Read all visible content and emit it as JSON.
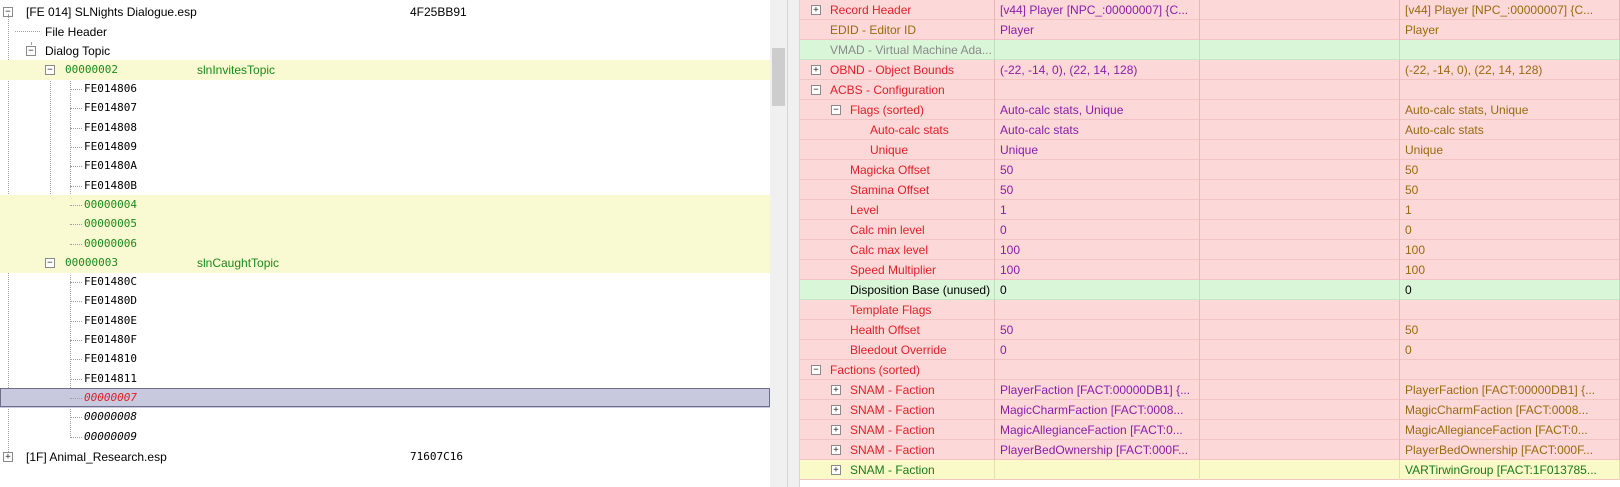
{
  "tree": {
    "root_esp": {
      "label": "[FE 014] SLNights Dialogue.esp",
      "crc": "4F25BB91"
    },
    "file_header": "File Header",
    "dialog_topic": "Dialog Topic",
    "topic1": {
      "id": "00000002",
      "name": "slnInvitesTopic"
    },
    "topic1_children": [
      "FE014806",
      "FE014807",
      "FE014808",
      "FE014809",
      "FE01480A",
      "FE01480B"
    ],
    "topic1_pending": [
      "00000004",
      "00000005",
      "00000006"
    ],
    "topic2": {
      "id": "00000003",
      "name": "slnCaughtTopic"
    },
    "topic2_children": [
      "FE01480C",
      "FE01480D",
      "FE01480E",
      "FE01480F",
      "FE014810",
      "FE014811"
    ],
    "selected": "00000007",
    "after_selected": [
      "00000008",
      "00000009"
    ],
    "next_esp": {
      "label": "[1F] Animal_Research.esp",
      "crc": "71607C16"
    }
  },
  "record": {
    "rows": [
      {
        "name": "Record Header",
        "v1": "[v44] Player [NPC_:00000007] {C...",
        "v3": "[v44] Player [NPC_:00000007] {C..."
      },
      {
        "name": "EDID - Editor ID",
        "v1": "Player",
        "v3": "Player"
      },
      {
        "name": "VMAD - Virtual Machine Ada...",
        "v1": "",
        "v3": ""
      },
      {
        "name": "OBND - Object Bounds",
        "v1": "(-22, -14, 0), (22, 14, 128)",
        "v3": "(-22, -14, 0), (22, 14, 128)"
      },
      {
        "name": "ACBS - Configuration",
        "v1": "",
        "v3": ""
      },
      {
        "name": "Flags (sorted)",
        "v1": "Auto-calc stats, Unique",
        "v3": "Auto-calc stats, Unique"
      },
      {
        "name": "Auto-calc stats",
        "v1": "Auto-calc stats",
        "v3": "Auto-calc stats"
      },
      {
        "name": "Unique",
        "v1": "Unique",
        "v3": "Unique"
      },
      {
        "name": "Magicka Offset",
        "v1": "50",
        "v3": "50"
      },
      {
        "name": "Stamina Offset",
        "v1": "50",
        "v3": "50"
      },
      {
        "name": "Level",
        "v1": "1",
        "v3": "1"
      },
      {
        "name": "Calc min level",
        "v1": "0",
        "v3": "0"
      },
      {
        "name": "Calc max level",
        "v1": "100",
        "v3": "100"
      },
      {
        "name": "Speed Multiplier",
        "v1": "100",
        "v3": "100"
      },
      {
        "name": "Disposition Base (unused)",
        "v1": "0",
        "v3": "0"
      },
      {
        "name": "Template Flags",
        "v1": "",
        "v3": ""
      },
      {
        "name": "Health Offset",
        "v1": "50",
        "v3": "50"
      },
      {
        "name": "Bleedout Override",
        "v1": "0",
        "v3": "0"
      },
      {
        "name": "Factions (sorted)",
        "v1": "",
        "v3": ""
      },
      {
        "name": "SNAM - Faction",
        "v1": "PlayerFaction [FACT:00000DB1] {...",
        "v3": "PlayerFaction [FACT:00000DB1] {..."
      },
      {
        "name": "SNAM - Faction",
        "v1": "MagicCharmFaction [FACT:0008...",
        "v3": "MagicCharmFaction [FACT:0008..."
      },
      {
        "name": "SNAM - Faction",
        "v1": "MagicAllegianceFaction [FACT:0...",
        "v3": "MagicAllegianceFaction [FACT:0..."
      },
      {
        "name": "SNAM - Faction",
        "v1": "PlayerBedOwnership [FACT:000F...",
        "v3": "PlayerBedOwnership [FACT:000F..."
      },
      {
        "name": "SNAM - Faction",
        "v1": "",
        "v3": "VARTirwinGroup [FACT:1F013785..."
      }
    ]
  },
  "colors": {
    "conflict_red": "#fcd8d8",
    "no_conflict_green": "#d9f6d9",
    "override_yellow": "#fafac8",
    "selected": "#c8c8de"
  }
}
